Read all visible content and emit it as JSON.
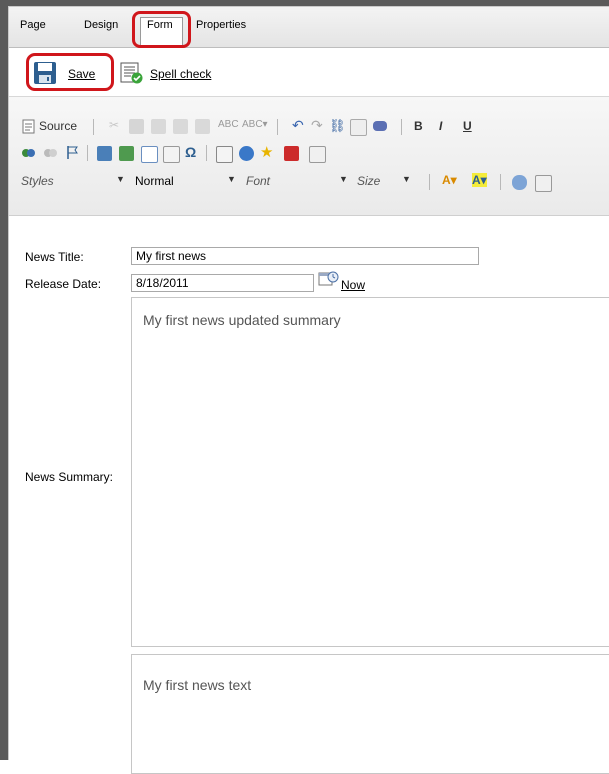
{
  "tabs": [
    {
      "label": "Page"
    },
    {
      "label": "Design"
    },
    {
      "label": "Form"
    },
    {
      "label": "Properties"
    }
  ],
  "actions": {
    "save_label": "Save",
    "spell_label": "Spell check"
  },
  "toolbar": {
    "source_label": "Source",
    "bold_label": "B",
    "italic_label": "I",
    "underline_label": "U",
    "styles_label": "Styles",
    "format_label": "Normal",
    "font_label": "Font",
    "size_label": "Size"
  },
  "form": {
    "title_label": "News Title:",
    "title_value": "My first news",
    "date_label": "Release Date:",
    "date_value": "8/18/2011",
    "now_label": "Now",
    "summary_label": "News Summary:",
    "summary_value": "My first news updated summary",
    "text_value": "My first news text"
  },
  "colors": {
    "highlight": "#d0161b",
    "frame": "#5a5a5a"
  }
}
